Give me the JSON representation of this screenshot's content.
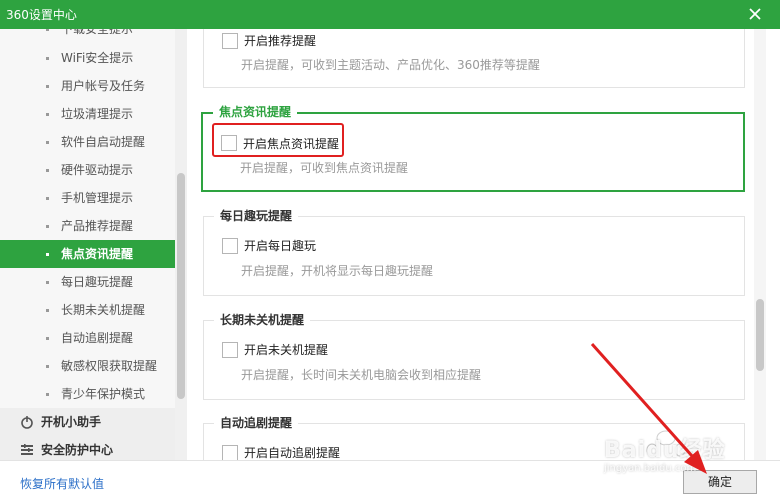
{
  "window": {
    "title": "360设置中心",
    "close_icon": "close-icon"
  },
  "sidebar": {
    "partial_item": "下载安全提示",
    "items": [
      {
        "label": "WiFi安全提示",
        "active": false
      },
      {
        "label": "用户帐号及任务",
        "active": false
      },
      {
        "label": "垃圾清理提示",
        "active": false
      },
      {
        "label": "软件自启动提醒",
        "active": false
      },
      {
        "label": "硬件驱动提示",
        "active": false
      },
      {
        "label": "手机管理提示",
        "active": false
      },
      {
        "label": "产品推荐提醒",
        "active": false
      },
      {
        "label": "焦点资讯提醒",
        "active": true
      },
      {
        "label": "每日趣玩提醒",
        "active": false
      },
      {
        "label": "长期未关机提醒",
        "active": false
      },
      {
        "label": "自动追剧提醒",
        "active": false
      },
      {
        "label": "敏感权限获取提醒",
        "active": false
      },
      {
        "label": "青少年保护模式",
        "active": false
      }
    ],
    "categories": [
      {
        "label": "开机小助手",
        "icon": "power-icon"
      },
      {
        "label": "安全防护中心",
        "icon": "shield-icon"
      }
    ]
  },
  "groups": [
    {
      "title": "",
      "checkbox_label": "开启推荐提醒",
      "description": "开启提醒，可收到主题活动、产品优化、360推荐等提醒",
      "checked": false
    },
    {
      "title": "焦点资讯提醒",
      "checkbox_label": "开启焦点资讯提醒",
      "description": "开启提醒，可收到焦点资讯提醒",
      "checked": false
    },
    {
      "title": "每日趣玩提醒",
      "checkbox_label": "开启每日趣玩",
      "description": "开启提醒，开机将显示每日趣玩提醒",
      "checked": false
    },
    {
      "title": "长期未关机提醒",
      "checkbox_label": "开启未关机提醒",
      "description": "开启提醒，长时间未关机电脑会收到相应提醒",
      "checked": false
    },
    {
      "title": "自动追剧提醒",
      "checkbox_label": "开启自动追剧提醒",
      "description": "",
      "checked": false
    }
  ],
  "footer": {
    "restore_label": "恢复所有默认值",
    "ok_label": "确定"
  },
  "watermark": {
    "line1": "Baidu经验",
    "line2": "jingyan.baidu.com"
  },
  "colors": {
    "accent": "#2ea340",
    "annotation_red": "#e02020",
    "link": "#2b6fc8"
  }
}
